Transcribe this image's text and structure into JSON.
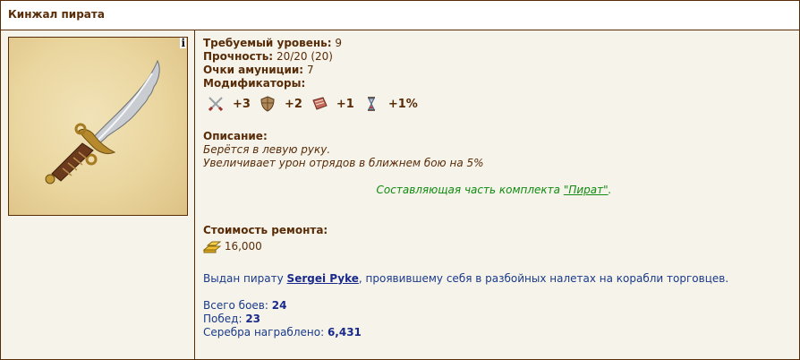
{
  "header": {
    "title": "Кинжал пирата"
  },
  "item": {
    "image_name": "pirate-dagger",
    "info_badge": "i",
    "required_level_label": "Требуемый уровень:",
    "required_level": "9",
    "durability_label": "Прочность:",
    "durability": "20/20",
    "durability_max": "(20)",
    "ammo_label": "Очки амуниции:",
    "ammo": "7",
    "modifiers_label": "Модификаторы:",
    "modifiers": [
      {
        "icon": "attack-icon",
        "value": "+3"
      },
      {
        "icon": "defense-icon",
        "value": "+2"
      },
      {
        "icon": "knowledge-icon",
        "value": "+1"
      },
      {
        "icon": "initiative-icon",
        "value": "+1%"
      }
    ],
    "description_label": "Описание:",
    "description_lines": [
      "Берётся в левую руку.",
      "Увеличивает урон отрядов в ближнем бою на 5%"
    ],
    "set_text_before": "Составляющая часть комплекта ",
    "set_name": "\"Пират\"",
    "set_text_after": ".",
    "repair_label": "Стоимость ремонта:",
    "repair_cost": "16,000",
    "issued_before": "Выдан пирату ",
    "player_name": "Sergei Pyke",
    "issued_after": ", проявившему себя в разбойных налетах на корабли торговцев.",
    "stats": {
      "battles_label": "Всего боев:",
      "battles": "24",
      "wins_label": "Побед:",
      "wins": "23",
      "silver_label": "Серебра награблено:",
      "silver": "6,431"
    }
  },
  "colors": {
    "text_brown": "#592c08",
    "panel_bg": "#f5f3ea",
    "set_green": "#118b11",
    "link_blue": "#1a2a8a"
  }
}
